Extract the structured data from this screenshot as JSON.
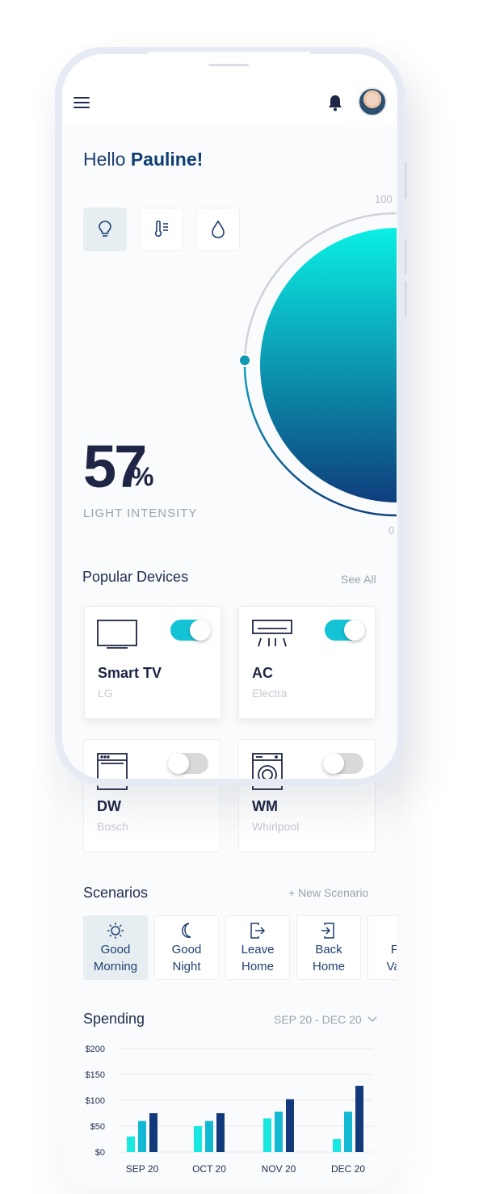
{
  "header": {
    "avatar_name": "Pauline"
  },
  "greeting": {
    "prefix": "Hello",
    "name": "Pauline!"
  },
  "modes": [
    {
      "id": "light",
      "icon": "lightbulb-icon",
      "active": true
    },
    {
      "id": "temperature",
      "icon": "thermometer-icon",
      "active": false
    },
    {
      "id": "humidity",
      "icon": "droplet-icon",
      "active": false
    }
  ],
  "intensity": {
    "value": "57",
    "unit": "%",
    "label": "LIGHT INTENSITY",
    "max_label": "100",
    "min_label": "0",
    "level": 0.57,
    "colors": {
      "start": "#0af0e4",
      "end": "#0e3e7d",
      "marker": "#0e98b4"
    }
  },
  "popular_devices": {
    "title": "Popular Devices",
    "see_all": "See All",
    "items": [
      {
        "name": "Smart TV",
        "brand": "LG",
        "icon": "tv-icon",
        "on": true
      },
      {
        "name": "AC",
        "brand": "Electra",
        "icon": "air-conditioner-icon",
        "on": true
      },
      {
        "name": "DW",
        "brand": "Bosch",
        "icon": "dishwasher-icon",
        "on": false
      },
      {
        "name": "WM",
        "brand": "Whirlpool",
        "icon": "washing-machine-icon",
        "on": false
      }
    ]
  },
  "scenarios": {
    "title": "Scenarios",
    "new_label": "+ New Scenario",
    "items": [
      {
        "label": "Good\nMorning",
        "icon": "sun-icon",
        "active": true
      },
      {
        "label": "Good\nNight",
        "icon": "moon-icon",
        "active": false
      },
      {
        "label": "Leave\nHome",
        "icon": "exit-icon",
        "active": false
      },
      {
        "label": "Back\nHome",
        "icon": "enter-icon",
        "active": false
      },
      {
        "label": "Far\nVaca",
        "icon": "vacation-icon",
        "active": false
      }
    ]
  },
  "spending": {
    "title": "Spending",
    "range": "SEP 20 - DEC 20"
  },
  "chart_data": {
    "type": "bar",
    "categories": [
      "SEP 20",
      "OCT 20",
      "NOV 20",
      "DEC 20"
    ],
    "series": [
      {
        "values": [
          30,
          50,
          65,
          25
        ],
        "color": "#19e8e0"
      },
      {
        "values": [
          60,
          60,
          78,
          78
        ],
        "color": "#13b9d3"
      },
      {
        "values": [
          75,
          75,
          102,
          128
        ],
        "color": "#123a7a"
      }
    ],
    "yticks": [
      "$200",
      "$150",
      "$100",
      "$50",
      "$0"
    ],
    "ylim": [
      0,
      200
    ],
    "grid": true
  }
}
